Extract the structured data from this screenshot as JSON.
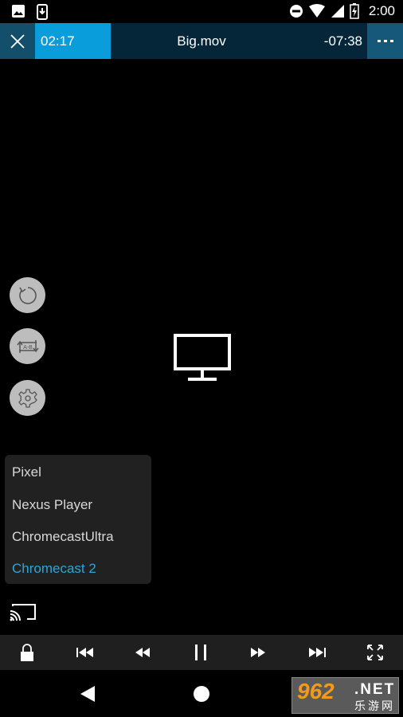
{
  "status_bar": {
    "left_icons": [
      "image-icon",
      "download-icon"
    ],
    "right_icons": [
      "do-not-disturb-icon",
      "wifi-icon",
      "cellular-signal-icon",
      "battery-charging-icon"
    ],
    "time": "2:00"
  },
  "top_bar": {
    "elapsed": "02:17",
    "title": "Big.mov",
    "remaining": "-07:38",
    "progress_percent": 22.7,
    "colors": {
      "progress": "#0a9ddb",
      "background": "#042638",
      "buttons": "#16587a"
    }
  },
  "side_buttons": [
    {
      "name": "repeat",
      "icon": "repeat-icon"
    },
    {
      "name": "ab-loop",
      "icon": "ab-repeat-icon",
      "label": "A-B"
    },
    {
      "name": "settings",
      "icon": "gear-icon"
    }
  ],
  "center_icon": "tv-icon",
  "cast_menu": {
    "devices": [
      {
        "label": "Pixel",
        "selected": false
      },
      {
        "label": "Nexus Player",
        "selected": false
      },
      {
        "label": "ChromecastUltra",
        "selected": false
      },
      {
        "label": "Chromecast 2",
        "selected": true
      }
    ],
    "selected_color": "#2ba6dc"
  },
  "controls": [
    "lock-icon",
    "skip-previous-icon",
    "rewind-icon",
    "pause-icon",
    "fast-forward-icon",
    "skip-next-icon",
    "fullscreen-icon"
  ],
  "nav_bar": [
    "back-icon",
    "home-icon"
  ],
  "watermark": {
    "number": "962",
    "suffix": ".NET",
    "subtitle": "乐游网"
  }
}
